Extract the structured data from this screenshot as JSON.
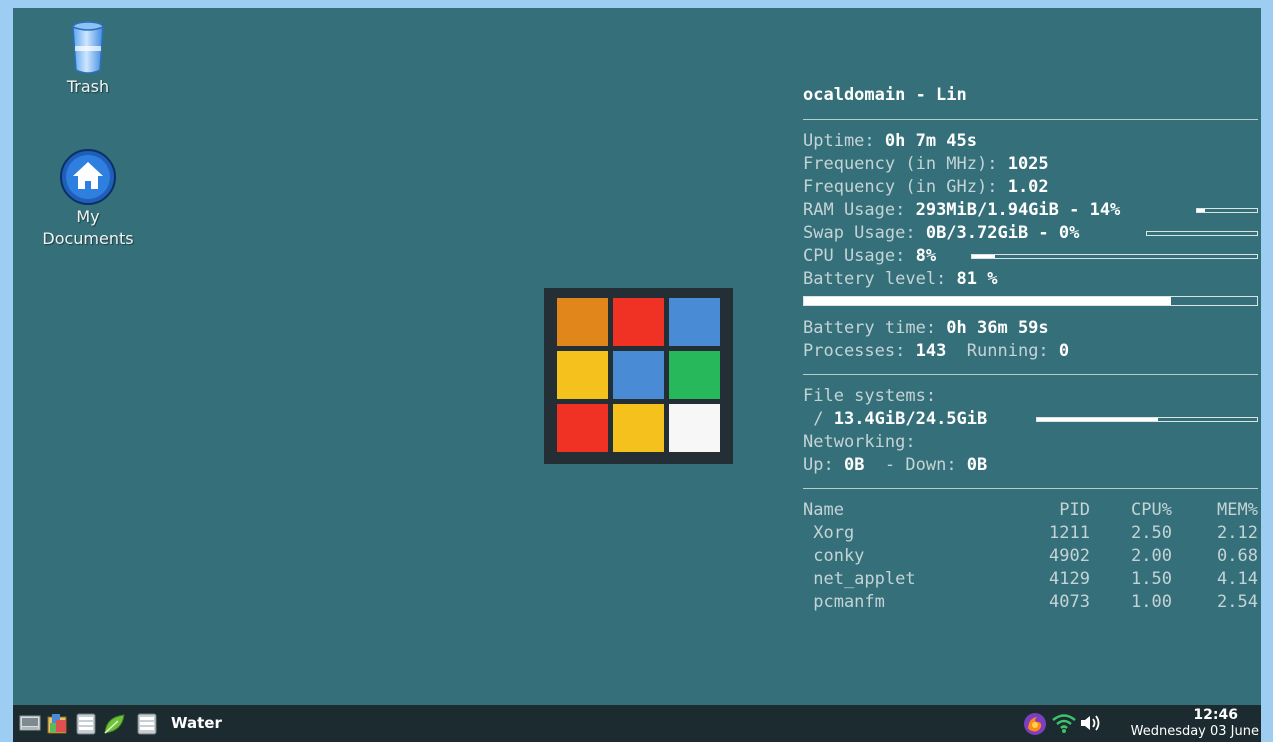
{
  "desktop": {
    "icons": [
      {
        "label": "Trash",
        "icon": "trash-icon"
      },
      {
        "label": "My\nDocuments",
        "label_line1": "My",
        "label_line2": "Documents",
        "icon": "home-icon"
      }
    ],
    "background_color": "#35707a"
  },
  "logo": {
    "tiles": [
      "#e0861a",
      "#ef3224",
      "#4a8bd6",
      "#f5c21d",
      "#4a8bd6",
      "#27b85c",
      "#ef3224",
      "#f5c21d",
      "#f7f7f7"
    ]
  },
  "conky": {
    "title": "ocaldomain - Lin",
    "uptime_label": "Uptime: ",
    "uptime_value": "0h 7m 45s",
    "freq_mhz_label": "Frequency (in MHz): ",
    "freq_mhz_value": "1025",
    "freq_ghz_label": "Frequency (in GHz): ",
    "freq_ghz_value": "1.02",
    "ram_label": "RAM Usage: ",
    "ram_value": "293MiB/1.94GiB - 14%",
    "ram_percent": 14,
    "swap_label": "Swap Usage: ",
    "swap_value": "0B/3.72GiB - 0%",
    "swap_percent": 0,
    "cpu_label": "CPU Usage: ",
    "cpu_value": "8%",
    "cpu_percent": 8,
    "battery_label": "Battery level: ",
    "battery_value": "81 %",
    "battery_percent": 81,
    "battery_time_label": "Battery time: ",
    "battery_time_value": "0h 36m 59s",
    "processes_label": "Processes: ",
    "processes_value": "143",
    "running_label": "  Running: ",
    "running_value": "0",
    "fs_label": "File systems:",
    "fs_path": " / ",
    "fs_value": "13.4GiB/24.5GiB",
    "fs_percent": 55,
    "net_label": "Networking:",
    "up_label": "Up: ",
    "up_value": "0B",
    "down_label": "  - Down: ",
    "down_value": "0B",
    "proc_headers": {
      "name": "Name",
      "pid": "PID",
      "cpu": "CPU%",
      "mem": "MEM%"
    },
    "proc_rows": [
      {
        "name": " Xorg",
        "pid": "1211",
        "cpu": "2.50",
        "mem": "2.12"
      },
      {
        "name": " conky",
        "pid": "4902",
        "cpu": "2.00",
        "mem": "0.68"
      },
      {
        "name": " net_applet",
        "pid": "4129",
        "cpu": "1.50",
        "mem": "4.14"
      },
      {
        "name": " pcmanfm",
        "pid": "4073",
        "cpu": "1.00",
        "mem": "2.54"
      }
    ]
  },
  "taskbar": {
    "launchers": [
      "show-desktop-icon",
      "file-manager-icon",
      "terminal-icon",
      "leaf-app-icon",
      "window-icon"
    ],
    "task_label": "Water",
    "tray": [
      "firefox-icon",
      "wifi-icon",
      "volume-icon"
    ],
    "clock_time": "12:46",
    "clock_date": "Wednesday 03 June"
  }
}
